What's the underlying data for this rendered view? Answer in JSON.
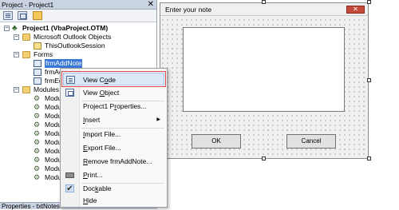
{
  "project_pane": {
    "title": "Project - Project1",
    "close_glyph": "✕",
    "tree": {
      "root_label": "Project1 (VbaProject.OTM)",
      "outlook_folder": "Microsoft Outlook Objects",
      "session_item": "ThisOutlookSession",
      "forms_folder": "Forms",
      "forms": [
        "frmAddNote",
        "frmAd",
        "frmEd"
      ],
      "modules_folder": "Modules",
      "modules": [
        "Module",
        "Module",
        "Module",
        "Module",
        "Module",
        "Module",
        "Module",
        "Module",
        "Module",
        "Module"
      ]
    },
    "properties_label": "Properties - txtNotes"
  },
  "designer": {
    "form_title": "Enter your note",
    "close_glyph": "✕",
    "ok_label": "OK",
    "cancel_label": "Cancel"
  },
  "context_menu": {
    "items": [
      {
        "pre": "View C",
        "key": "o",
        "post": "de"
      },
      {
        "pre": "View ",
        "key": "O",
        "post": "bject"
      },
      {
        "pre": "Project1 P",
        "key": "r",
        "post": "operties..."
      },
      {
        "pre": "",
        "key": "I",
        "post": "nsert"
      },
      {
        "pre": "",
        "key": "I",
        "post": "mport File..."
      },
      {
        "pre": "",
        "key": "E",
        "post": "xport File..."
      },
      {
        "pre": "",
        "key": "R",
        "post": "emove frmAddNote..."
      },
      {
        "pre": "",
        "key": "P",
        "post": "rint..."
      },
      {
        "pre": "Doc",
        "key": "k",
        "post": "able"
      },
      {
        "pre": "",
        "key": "H",
        "post": "ide"
      }
    ],
    "submenu_arrow": "▶",
    "check_glyph": "✔"
  }
}
